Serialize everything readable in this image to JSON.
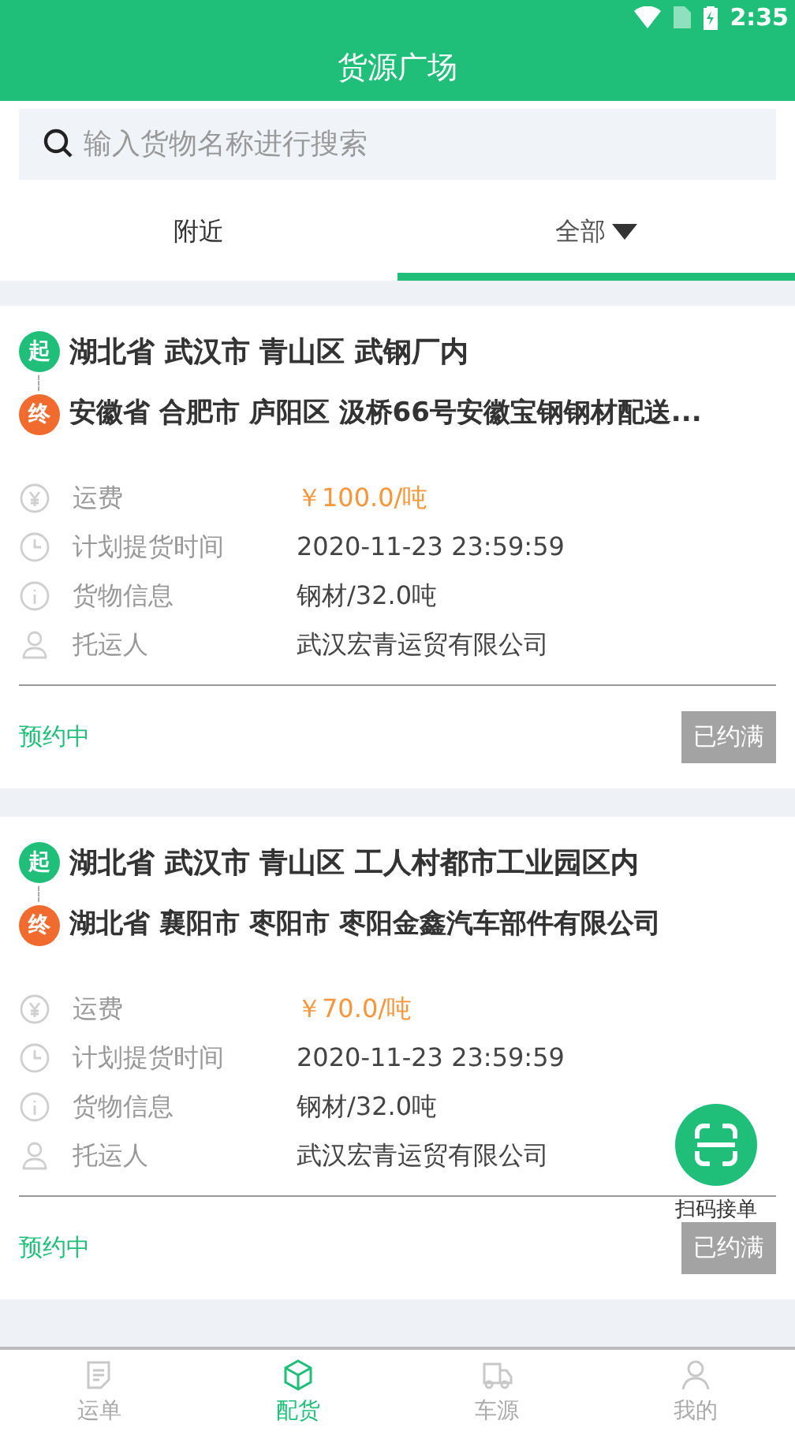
{
  "status_bar": {
    "time": "2:35"
  },
  "header": {
    "title": "货源广场"
  },
  "search": {
    "placeholder": "输入货物名称进行搜索"
  },
  "tabs": [
    {
      "label": "附近",
      "selected": false,
      "dropdown": false
    },
    {
      "label": "全部",
      "selected": true,
      "dropdown": true
    }
  ],
  "cards": [
    {
      "origin_badge": "起",
      "origin": "湖北省 武汉市 青山区 武钢厂内",
      "dest_badge": "终",
      "destination": "安徽省 合肥市 庐阳区 汲桥66号安徽宝钢钢材配送...",
      "info": [
        {
          "kind": "fee",
          "label": "运费",
          "value": "￥100.0/吨"
        },
        {
          "kind": "time",
          "label": "计划提货时间",
          "value": "2020-11-23 23:59:59"
        },
        {
          "kind": "info",
          "label": "货物信息",
          "value": "钢材/32.0吨"
        },
        {
          "kind": "person",
          "label": "托运人",
          "value": "武汉宏青运贸有限公司"
        }
      ],
      "status": "预约中",
      "action": {
        "label": "已约满",
        "disabled": true
      }
    },
    {
      "origin_badge": "起",
      "origin": "湖北省 武汉市 青山区 工人村都市工业园区内",
      "dest_badge": "终",
      "destination": "湖北省 襄阳市 枣阳市 枣阳金鑫汽车部件有限公司",
      "info": [
        {
          "kind": "fee",
          "label": "运费",
          "value": "￥70.0/吨"
        },
        {
          "kind": "time",
          "label": "计划提货时间",
          "value": "2020-11-23 23:59:59"
        },
        {
          "kind": "info",
          "label": "货物信息",
          "value": "钢材/32.0吨"
        },
        {
          "kind": "person",
          "label": "托运人",
          "value": "武汉宏青运贸有限公司"
        }
      ],
      "status": "预约中",
      "action": {
        "label": "已约满",
        "disabled": true
      }
    }
  ],
  "scan_button": {
    "label": "扫码接单"
  },
  "bottom_nav": [
    {
      "kind": "waybill",
      "label": "运单",
      "selected": false
    },
    {
      "kind": "cargo",
      "label": "配货",
      "selected": true
    },
    {
      "kind": "truck",
      "label": "车源",
      "selected": false
    },
    {
      "kind": "me",
      "label": "我的",
      "selected": false
    }
  ]
}
